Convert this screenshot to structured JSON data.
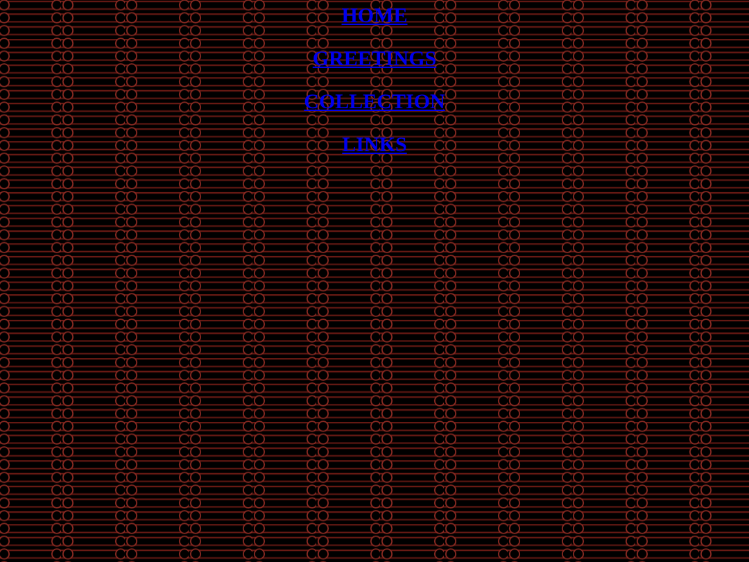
{
  "nav_links": [
    {
      "label": "HOME"
    },
    {
      "label": "GREETINGS"
    },
    {
      "label": "COLLECTION"
    },
    {
      "label": "LINKS"
    }
  ]
}
